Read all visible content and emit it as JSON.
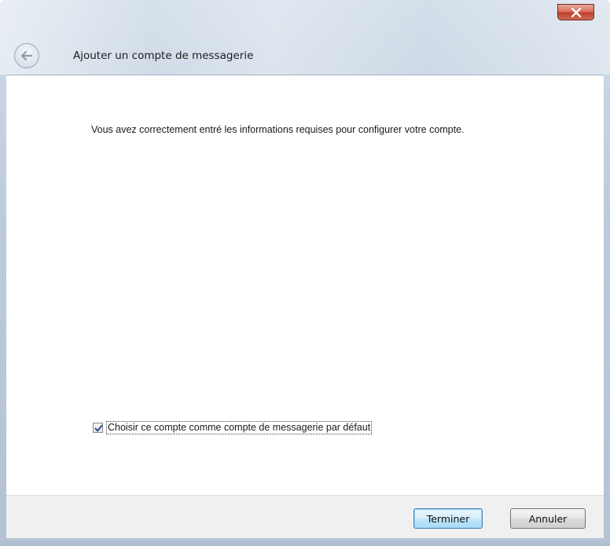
{
  "window": {
    "title": "Ajouter un compte de messagerie",
    "close_icon": "close-icon"
  },
  "nav": {
    "back_icon": "back-arrow-icon"
  },
  "content": {
    "info_text": "Vous avez correctement entré les informations requises pour configurer votre compte.",
    "default_account": {
      "label": "Choisir ce compte comme compte de messagerie par défaut",
      "checked": true
    }
  },
  "footer": {
    "finish_label": "Terminer",
    "cancel_label": "Annuler"
  },
  "colors": {
    "close_red": "#c0402c",
    "frame_blue": "#bccbdc",
    "default_button_border": "#3c7fb1"
  }
}
